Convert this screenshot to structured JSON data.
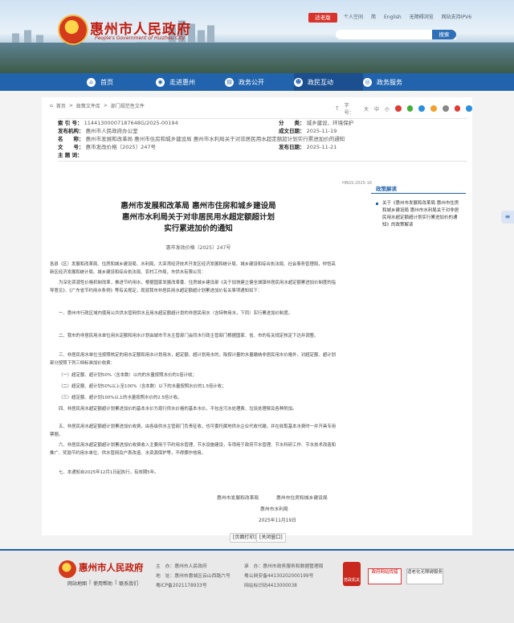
{
  "header": {
    "site_title": "惠州市人民政府",
    "site_title_en": "People's Government of Huizhou City",
    "elder_mode": "适老版",
    "links": [
      "个人空间",
      "简",
      "English",
      "无障碍浏览",
      "网站支持IPV6"
    ],
    "search_button": "搜索"
  },
  "nav": [
    "首页",
    "走进惠州",
    "政务公开",
    "政民互动",
    "政务服务"
  ],
  "breadcrumb": [
    "首页",
    "政策文件库",
    "部门规范性文件"
  ],
  "fontsize": {
    "label": "字号：",
    "big": "大",
    "mid": "中",
    "small": "小"
  },
  "meta": {
    "index_label": "索 引 号：",
    "index_value": "11441300007187648G/2025-00194",
    "category_label": "分　　类：",
    "category_value": "城乡建设、环境保护",
    "publisher_label": "发布机构：",
    "publisher_value": "惠州市人民政府办公室",
    "date_label": "成文日期：",
    "date_value": "2025-11-19",
    "title_label": "名　　称：",
    "title_value": "惠州市发展和改革局 惠州市住房和城乡建设局 惠州市水利局关于对非居民用水超定额超计划实行累进加价的通知",
    "docno_label": "文　　号：",
    "docno_value": "惠市发改价格〔2025〕247号",
    "pubdate_label": "发布日期：",
    "pubdate_value": "2025-11-21",
    "keywords_label": "主 题 词：",
    "keywords_value": ""
  },
  "article": {
    "serial": "HBGS-2025-16",
    "title_lines": [
      "惠州市发展和改革局 惠州市住房和城乡建设局",
      "惠州市水利局关于对非居民用水超定额超计划",
      "实行累进加价的通知"
    ],
    "docno": "惠市发改价格〔2025〕247号",
    "paragraphs": [
      "各县（区）发展和改革局、住房和城乡建设局、水利局，大亚湾经济技术开发区经济发展和统计局、城乡建设和综合执法局、社会事务管理局，仲恺高新区经济发展和统计局、城乡建设和综合执法局、农村工作局，市供水有限公司：",
      "为深化资源性价格机制改革，推进节约用水，根据国家发展改革委、住房城乡建设部《关于加快建立健全城镇非居民用水超定额累进加价制度的指导意见》、《广东省节约用水条例》等有关规定，现就我市非居民用水超定额超计划累进加价有关事项通知如下：",
      "一、惠州市行政区域内使用公共供水管网供水且用水超定额超计划的非居民用水（含特种用水，下同）实行累进加价制度。",
      "二、我市的非居民用水单位用水定额和用水计划由城市节水主管部门会同水行政主管部门根据国家、省、市的有关规定核定下达并调整。",
      "三、非居民用水单位当按照核定的用水定额和用水计划用水，超定额、超计划用水的，除按计量的水量缴纳非居民用水价格外，对超定额、超计划部分按照下列三档标准加价收费：",
      "（一）超定额、超计划50%（含本数）以内的水量按照水价的1倍计收；",
      "（二）超定额、超计划50%以上至100%（含本数）以下的水量按照水价的1.5倍计收；",
      "（三）超定额、超计划100%以上的水量按照水价的2.5倍计收。",
      "四、非居民用水超定额超计划累进加价的基本水价为现行供水价格的基本水价，不包含污水处理费、垃圾处理费及各种附加。",
      "五、非居民用水超定额超计划累进加价收费，由各级供水主管部门负责征收，也可委托属地供水企业代收代缴，并在收取基本水费时一并开具专用票据。",
      "六、非居民用水超定额超计划累进加价收费收入主要用于节约用水管理、节水设施建设，专项用于政府节水管理、节水科研工作、节水技术改造和推广、奖励节约用水单位、供水管网及户表改造、水资源保护等，不得挪作他用。",
      "七、本通知自2025年12月1日起执行，有效期5年。"
    ],
    "sign_left": "惠州市发展和改革局",
    "sign_right": "惠州市住房和城乡建设局",
    "sign_water": "惠州市水利局",
    "sign_date": "2025年11月19日",
    "print_button": "[页面打印]",
    "close_button": "[关闭窗口]"
  },
  "sidebar": {
    "title": "政策解读",
    "item": "关于《惠州市发展和改革局 惠州市住房和城乡建设局 惠州市水利局关于对非居民用水超定额超计划实行累进加价的通知》的政策解读"
  },
  "float_icon": "tag",
  "footer": {
    "site_title": "惠州市人民政府",
    "links": [
      "网站地图",
      "使用帮助",
      "联系我们"
    ],
    "sponsor_label": "主　办：",
    "sponsor": "惠州市人民政府",
    "address_label": "地　址：",
    "address": "惠州市惠城区云山西路六号",
    "org_label": "承　办：",
    "org": "惠州市政务服务和数据管理局",
    "police": "粤公网安备44130202000199号",
    "icp": "粤ICP备2021178933号",
    "site_id": "网站标识码4413000038",
    "badge": "党政机关",
    "error_label": "政府网站找错",
    "elder_label": "适老化无障碍服务"
  }
}
